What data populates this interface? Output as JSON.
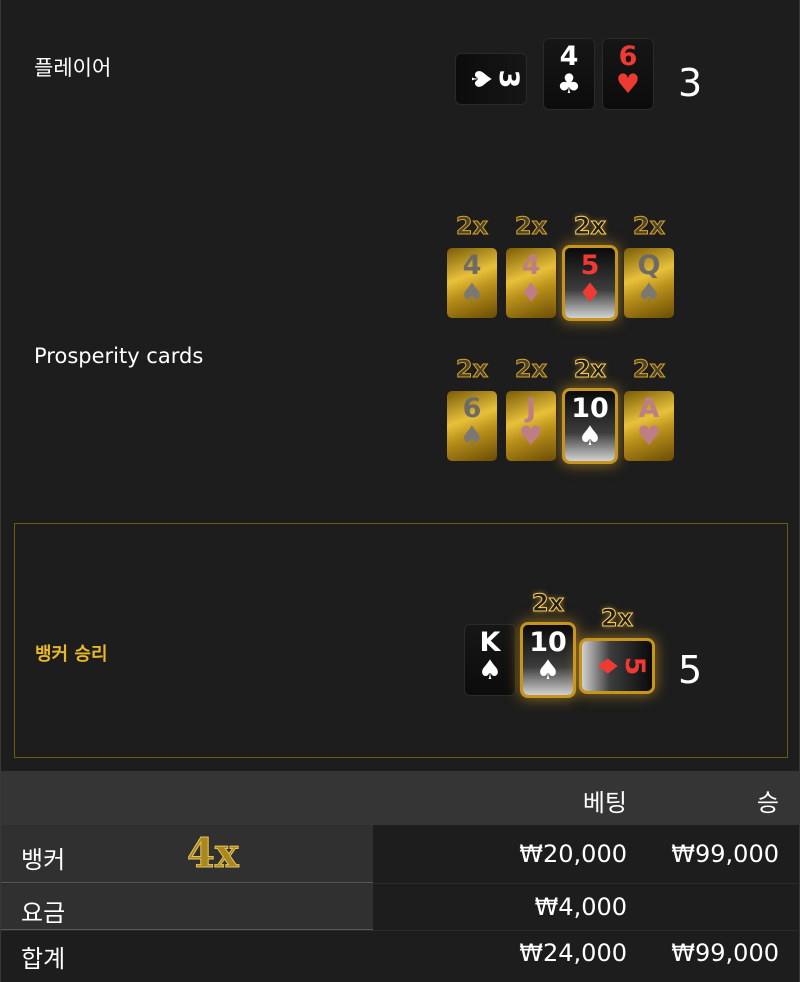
{
  "player": {
    "label": "플레이어",
    "score": "3",
    "cards": [
      {
        "rank": "3",
        "suit": "♠",
        "color": "white",
        "rotated": true
      },
      {
        "rank": "4",
        "suit": "♣",
        "color": "white",
        "rotated": false
      },
      {
        "rank": "6",
        "suit": "♥",
        "color": "red",
        "rotated": false
      }
    ]
  },
  "prosperity": {
    "label": "Prosperity cards",
    "row1": [
      {
        "mult": "2x",
        "rank": "4",
        "suit": "♠",
        "style": "gold"
      },
      {
        "mult": "2x",
        "rank": "4",
        "suit": "♦",
        "style": "gold-pink"
      },
      {
        "mult": "2x",
        "rank": "5",
        "suit": "♦",
        "style": "highlight-red"
      },
      {
        "mult": "2x",
        "rank": "Q",
        "suit": "♠",
        "style": "gold"
      }
    ],
    "row2": [
      {
        "mult": "2x",
        "rank": "6",
        "suit": "♠",
        "style": "gold"
      },
      {
        "mult": "2x",
        "rank": "J",
        "suit": "♥",
        "style": "gold-pink"
      },
      {
        "mult": "2x",
        "rank": "10",
        "suit": "♠",
        "style": "highlight-white"
      },
      {
        "mult": "2x",
        "rank": "A",
        "suit": "♥",
        "style": "gold-pink"
      }
    ]
  },
  "banker": {
    "label": "뱅커 승리",
    "score": "5",
    "cards": [
      {
        "rank": "K",
        "suit": "♠",
        "color": "white",
        "mult": ""
      },
      {
        "rank": "10",
        "suit": "♠",
        "color": "white",
        "mult": "2x"
      },
      {
        "rank": "5",
        "suit": "♦",
        "color": "red",
        "mult": "2x"
      }
    ]
  },
  "table": {
    "headers": {
      "bet": "베팅",
      "win": "승"
    },
    "rows": [
      {
        "label": "뱅커",
        "mult": "4x",
        "bet": "₩20,000",
        "win": "₩99,000"
      },
      {
        "label": "요금",
        "mult": "",
        "bet": "₩4,000",
        "win": ""
      },
      {
        "label": "합계",
        "mult": "",
        "bet": "₩24,000",
        "win": "₩99,000"
      }
    ]
  },
  "colors": {
    "accent": "#e7b82c",
    "background": "#1d1d1d",
    "red_suit": "#ef3a34"
  }
}
